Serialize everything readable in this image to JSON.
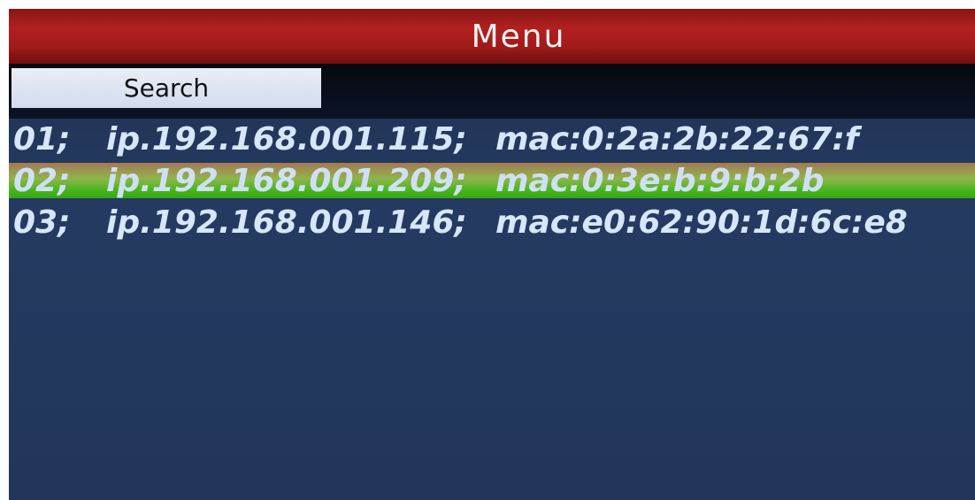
{
  "title": "Menu",
  "toolbar": {
    "search_label": "Search"
  },
  "devices": [
    {
      "index": "01;",
      "ip": "ip.192.168.001.115;",
      "mac": "mac:0:2a:2b:22:67:f"
    },
    {
      "index": "02;",
      "ip": "ip.192.168.001.209;",
      "mac": "mac:0:3e:b:9:b:2b"
    },
    {
      "index": "03;",
      "ip": "ip.192.168.001.146;",
      "mac": "mac:e0:62:90:1d:6c:e8"
    }
  ],
  "selected_index": 1,
  "colors": {
    "title_bar": "#b22020",
    "selection": "#42b51a",
    "background": "#243a60",
    "text": "#d6e6fb"
  }
}
